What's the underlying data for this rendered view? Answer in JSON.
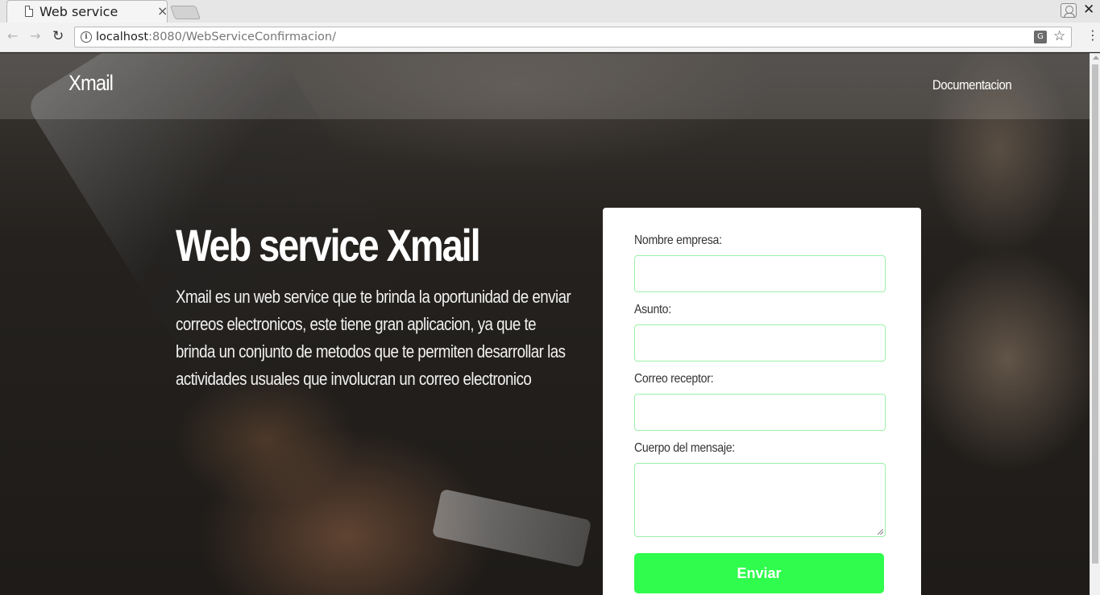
{
  "browser": {
    "tab_title": "Web service",
    "url_host": "localhost",
    "url_rest": ":8080/WebServiceConfirmacion/",
    "close_glyph": "×",
    "window_close_glyph": "✕"
  },
  "header": {
    "brand": "Xmail",
    "nav_link": "Documentacion"
  },
  "hero": {
    "title": "Web service Xmail",
    "description": "Xmail es un web service que te brinda la oportunidad de enviar correos electronicos, este tiene gran aplicacion, ya que te brinda un conjunto de metodos que te permiten desarrollar las actividades usuales que involucran un correo electronico"
  },
  "form": {
    "company_label": "Nombre empresa:",
    "company_value": "",
    "subject_label": "Asunto:",
    "subject_value": "",
    "recipient_label": "Correo receptor:",
    "recipient_value": "",
    "body_label": "Cuerpo del mensaje:",
    "body_value": "",
    "submit_label": "Enviar"
  },
  "colors": {
    "accent": "#2ffc4c",
    "input_border": "#9cf0a8"
  },
  "icons": {
    "tab": "document-icon",
    "back": "arrow-left-icon",
    "forward": "arrow-right-icon",
    "reload": "reload-icon",
    "site_info": "info-icon",
    "translate": "translate-icon",
    "bookmark": "star-icon",
    "menu": "menu-icon",
    "profile": "profile-icon"
  }
}
